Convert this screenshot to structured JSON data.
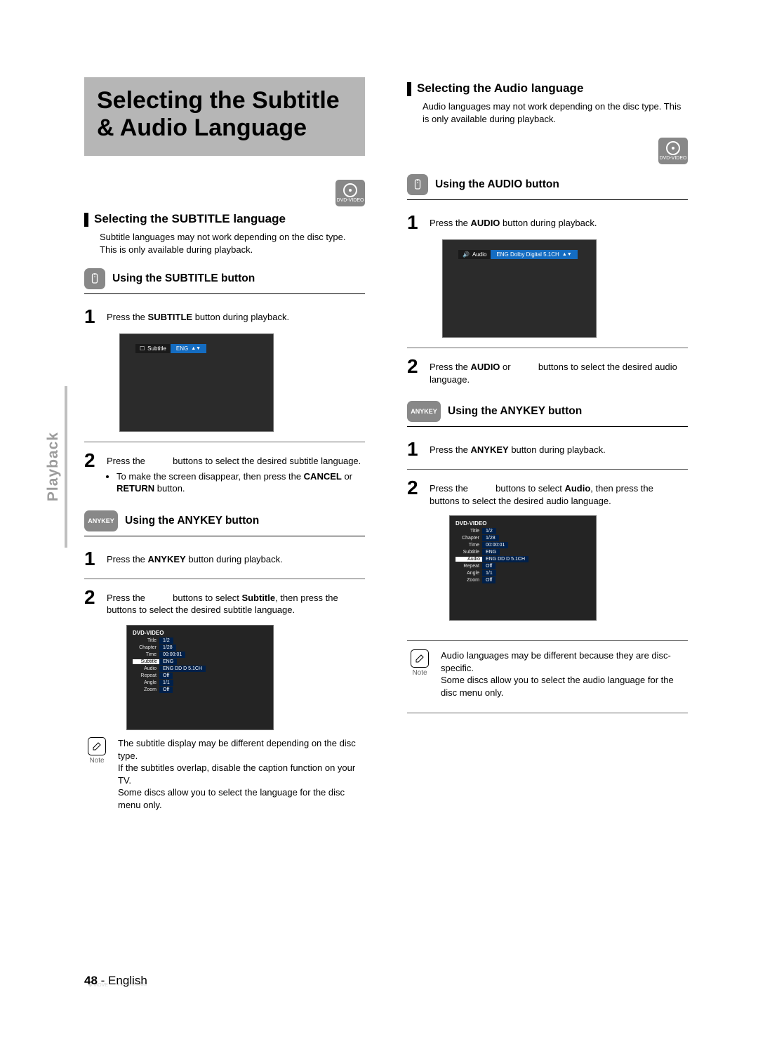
{
  "page": {
    "number": "48",
    "sep": " - ",
    "lang": "English",
    "side_tab": "Playback"
  },
  "title": "Selecting the Subtitle & Audio Language",
  "left": {
    "section_heading": "Selecting the SUBTITLE language",
    "section_note": "Subtitle languages may not work depending on the disc type. This is only available during playback.",
    "sub1": {
      "heading": "Using the SUBTITLE button",
      "step1_a": "Press the ",
      "step1_b": "SUBTITLE",
      "step1_c": " button during playback.",
      "osd_label": "Subtitle",
      "osd_value": "ENG",
      "step2_a": "Press the   ",
      "step2_b": " buttons to select the desired subtitle language.",
      "bullet_a": "To make the screen disappear, then press the ",
      "bullet_b": "CANCEL",
      "bullet_or": " or ",
      "bullet_c": "RETURN",
      "bullet_d": " button."
    },
    "sub2": {
      "pill": "ANYKEY",
      "heading": "Using the ANYKEY button",
      "step1_a": "Press the ",
      "step1_b": "ANYKEY",
      "step1_c": " button during playback.",
      "step2_a": "Press the   ",
      "step2_b": " buttons to select ",
      "step2_c": "Subtitle",
      "step2_d": ", then press the   ",
      "step2_e": " buttons to select the desired subtitle language."
    },
    "note": "The subtitle display may be different depending on the disc type.\nIf the subtitles overlap, disable the caption function on your TV.\nSome discs allow you to select the language for the disc menu only."
  },
  "right": {
    "section_heading": "Selecting the Audio language",
    "section_note": "Audio languages may not work depending on the disc type. This is only available during playback.",
    "sub1": {
      "heading": "Using the AUDIO button",
      "step1_a": "Press the ",
      "step1_b": "AUDIO",
      "step1_c": " button during playback.",
      "osd_label": "Audio",
      "osd_value": "ENG Dolby Digital 5.1CH",
      "step2_a": "Press the ",
      "step2_b": "AUDIO",
      "step2_c": " or   ",
      "step2_d": " buttons to select the desired audio language."
    },
    "sub2": {
      "pill": "ANYKEY",
      "heading": "Using the ANYKEY button",
      "step1_a": "Press the ",
      "step1_b": "ANYKEY",
      "step1_c": " button during playback.",
      "step2_a": "Press the   ",
      "step2_b": " buttons to select ",
      "step2_c": "Audio",
      "step2_d": ", then press the   ",
      "step2_e": " buttons to select the desired audio language."
    },
    "note": "Audio languages may be different because they are disc-specific.\nSome discs allow you to select the audio language for the disc menu only."
  },
  "dvd_menu": {
    "header": "DVD-VIDEO",
    "rows": [
      {
        "key": "Title",
        "val": "1/2"
      },
      {
        "key": "Chapter",
        "val": "1/28"
      },
      {
        "key": "Time",
        "val": "00:00:01"
      },
      {
        "key": "Subtitle",
        "val": "ENG",
        "sel_left": true
      },
      {
        "key": "Audio",
        "val": "ENG DD D 5.1CH",
        "sel_right": true
      },
      {
        "key": "Repeat",
        "val": "Off"
      },
      {
        "key": "Angle",
        "val": "1/1"
      },
      {
        "key": "Zoom",
        "val": "Off"
      }
    ],
    "footer_move": "MOVE",
    "footer_change": "CHANGE"
  },
  "badge_label": "DVD-VIDEO",
  "note_label": "Note"
}
